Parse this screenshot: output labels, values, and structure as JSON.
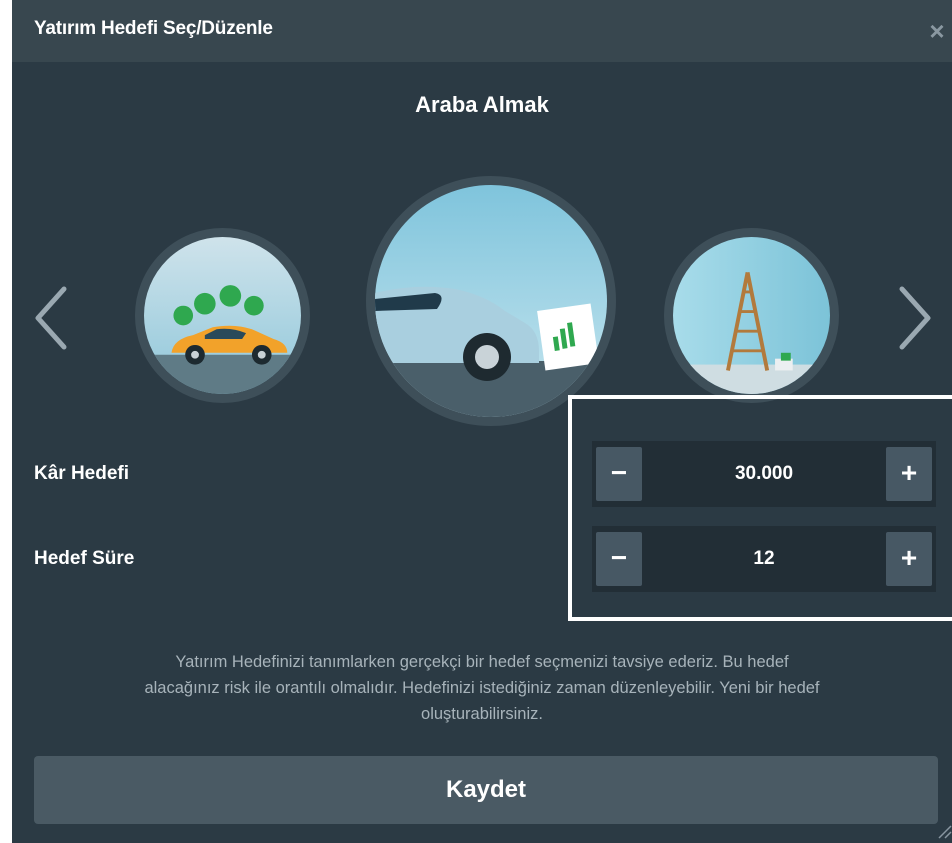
{
  "dialog": {
    "title": "Yatırım Hedefi Seç/Düzenle",
    "close_glyph": "×"
  },
  "carousel": {
    "selected_goal": "Araba Almak",
    "icons": {
      "prev": "chevron-left-icon",
      "next": "chevron-right-icon"
    }
  },
  "fields": {
    "profit": {
      "label": "Kâr Hedefi",
      "value": "30.000",
      "minus": "−",
      "plus": "+"
    },
    "duration": {
      "label": "Hedef Süre",
      "value": "12",
      "minus": "−",
      "plus": "+"
    }
  },
  "info": {
    "line1": "Yatırım Hedefinizi tanımlarken gerçekçi bir hedef seçmenizi tavsiye ederiz. Bu hedef",
    "line2": "alacağınız risk ile orantılı olmalıdır. Hedefinizi istediğiniz zaman düzenleyebilir. Yeni bir hedef",
    "line3": "oluşturabilirsiniz."
  },
  "actions": {
    "save_label": "Kaydet"
  },
  "colors": {
    "background": "#2b3a44",
    "titlebar": "#38474f",
    "stepper_bg": "#222e36",
    "stepper_button": "#475864",
    "save_button": "#4a5a64",
    "highlight_border": "#ffffff"
  }
}
